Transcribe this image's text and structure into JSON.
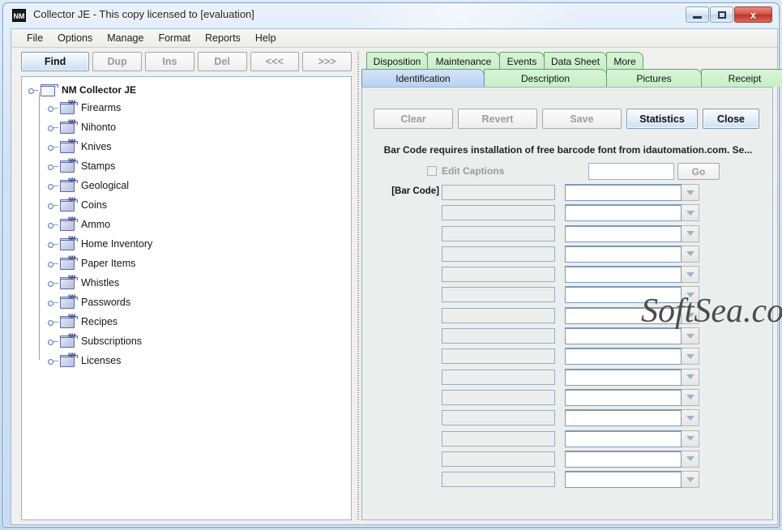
{
  "window": {
    "app_icon_text": "NM",
    "title": "Collector JE - This copy licensed to [evaluation]",
    "minimize_label": "",
    "maximize_label": "",
    "close_label": "x"
  },
  "menubar": {
    "items": [
      {
        "label": "File"
      },
      {
        "label": "Options"
      },
      {
        "label": "Manage"
      },
      {
        "label": "Format"
      },
      {
        "label": "Reports"
      },
      {
        "label": "Help"
      }
    ]
  },
  "toolbar": {
    "buttons": [
      {
        "label": "Find",
        "enabled": true
      },
      {
        "label": "Dup",
        "enabled": false
      },
      {
        "label": "Ins",
        "enabled": false
      },
      {
        "label": "Del",
        "enabled": false
      },
      {
        "label": "<<<",
        "enabled": false
      },
      {
        "label": ">>>",
        "enabled": false
      }
    ]
  },
  "tree": {
    "root": {
      "label": "NM Collector JE"
    },
    "nodes": [
      {
        "label": "Firearms"
      },
      {
        "label": "Nihonto"
      },
      {
        "label": "Knives"
      },
      {
        "label": "Stamps"
      },
      {
        "label": "Geological"
      },
      {
        "label": "Coins"
      },
      {
        "label": "Ammo"
      },
      {
        "label": "Home Inventory"
      },
      {
        "label": "Paper Items"
      },
      {
        "label": "Whistles"
      },
      {
        "label": "Passwords"
      },
      {
        "label": "Recipes"
      },
      {
        "label": "Subscriptions"
      },
      {
        "label": "Licenses"
      }
    ],
    "folder_badge": "NM"
  },
  "tabs": {
    "row1": [
      {
        "label": "Disposition",
        "selected": false
      },
      {
        "label": "Maintenance",
        "selected": false
      },
      {
        "label": "Events",
        "selected": false
      },
      {
        "label": "Data Sheet",
        "selected": false
      },
      {
        "label": "More",
        "selected": false
      }
    ],
    "row2": [
      {
        "label": "Identification",
        "selected": true
      },
      {
        "label": "Description",
        "selected": false
      },
      {
        "label": "Pictures",
        "selected": false
      },
      {
        "label": "Receipt",
        "selected": false
      }
    ]
  },
  "form": {
    "actions": [
      {
        "label": "Clear",
        "enabled": false
      },
      {
        "label": "Revert",
        "enabled": false
      },
      {
        "label": "Save",
        "enabled": false
      },
      {
        "label": "Statistics",
        "enabled": true
      },
      {
        "label": "Close",
        "enabled": true
      }
    ],
    "barcode_note": "Bar Code requires installation of free barcode font from idautomation.com.  Se...",
    "edit_captions_label": "Edit Captions",
    "edit_captions_checked": false,
    "search_value": "",
    "search_placeholder": "",
    "go_label": "Go",
    "rows": [
      {
        "caption": "[Bar Code]",
        "left_value": "",
        "right_value": ""
      },
      {
        "caption": "",
        "left_value": "",
        "right_value": ""
      },
      {
        "caption": "",
        "left_value": "",
        "right_value": ""
      },
      {
        "caption": "",
        "left_value": "",
        "right_value": ""
      },
      {
        "caption": "",
        "left_value": "",
        "right_value": ""
      },
      {
        "caption": "",
        "left_value": "",
        "right_value": ""
      },
      {
        "caption": "",
        "left_value": "",
        "right_value": ""
      },
      {
        "caption": "",
        "left_value": "",
        "right_value": ""
      },
      {
        "caption": "",
        "left_value": "",
        "right_value": ""
      },
      {
        "caption": "",
        "left_value": "",
        "right_value": ""
      },
      {
        "caption": "",
        "left_value": "",
        "right_value": ""
      },
      {
        "caption": "",
        "left_value": "",
        "right_value": ""
      },
      {
        "caption": "",
        "left_value": "",
        "right_value": ""
      },
      {
        "caption": "",
        "left_value": "",
        "right_value": ""
      },
      {
        "caption": "",
        "left_value": "",
        "right_value": ""
      }
    ]
  },
  "watermark": {
    "text": "SoftSea.com"
  },
  "colors": {
    "tab_green": "#c7efc6",
    "tab_selected_blue": "#b9d2ef",
    "close_red": "#bc3327",
    "panel_gray": "#eceeee",
    "field_border": "#7d9ab8"
  }
}
